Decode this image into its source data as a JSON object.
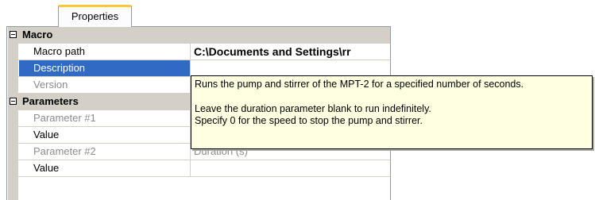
{
  "tab": {
    "label": "Properties"
  },
  "grid": {
    "categories": {
      "macro": "Macro",
      "parameters": "Parameters"
    },
    "rows": {
      "macro_path": {
        "name": "Macro path",
        "value": "C:\\Documents and Settings\\rr"
      },
      "description": {
        "name": "Description",
        "value": ""
      },
      "version": {
        "name": "Version",
        "value": ""
      },
      "param1": {
        "name": "Parameter #1",
        "value": ""
      },
      "value1": {
        "name": "Value",
        "value": ""
      },
      "param2": {
        "name": "Parameter #2",
        "value": "Duration (s)"
      },
      "value2": {
        "name": "Value",
        "value": ""
      }
    }
  },
  "tooltip": {
    "line1": "Runs the pump and stirrer of the MPT-2 for a specified number of seconds.",
    "line2": "Leave the duration parameter blank to run indefinitely.",
    "line3": "Specify 0 for the speed to stop the pump and stirrer."
  },
  "colors": {
    "selection": "#316ac5",
    "tooltip_bg": "#ffffe1",
    "category_bg": "#d4d0c8",
    "tab_accent": "#ffc73c"
  }
}
